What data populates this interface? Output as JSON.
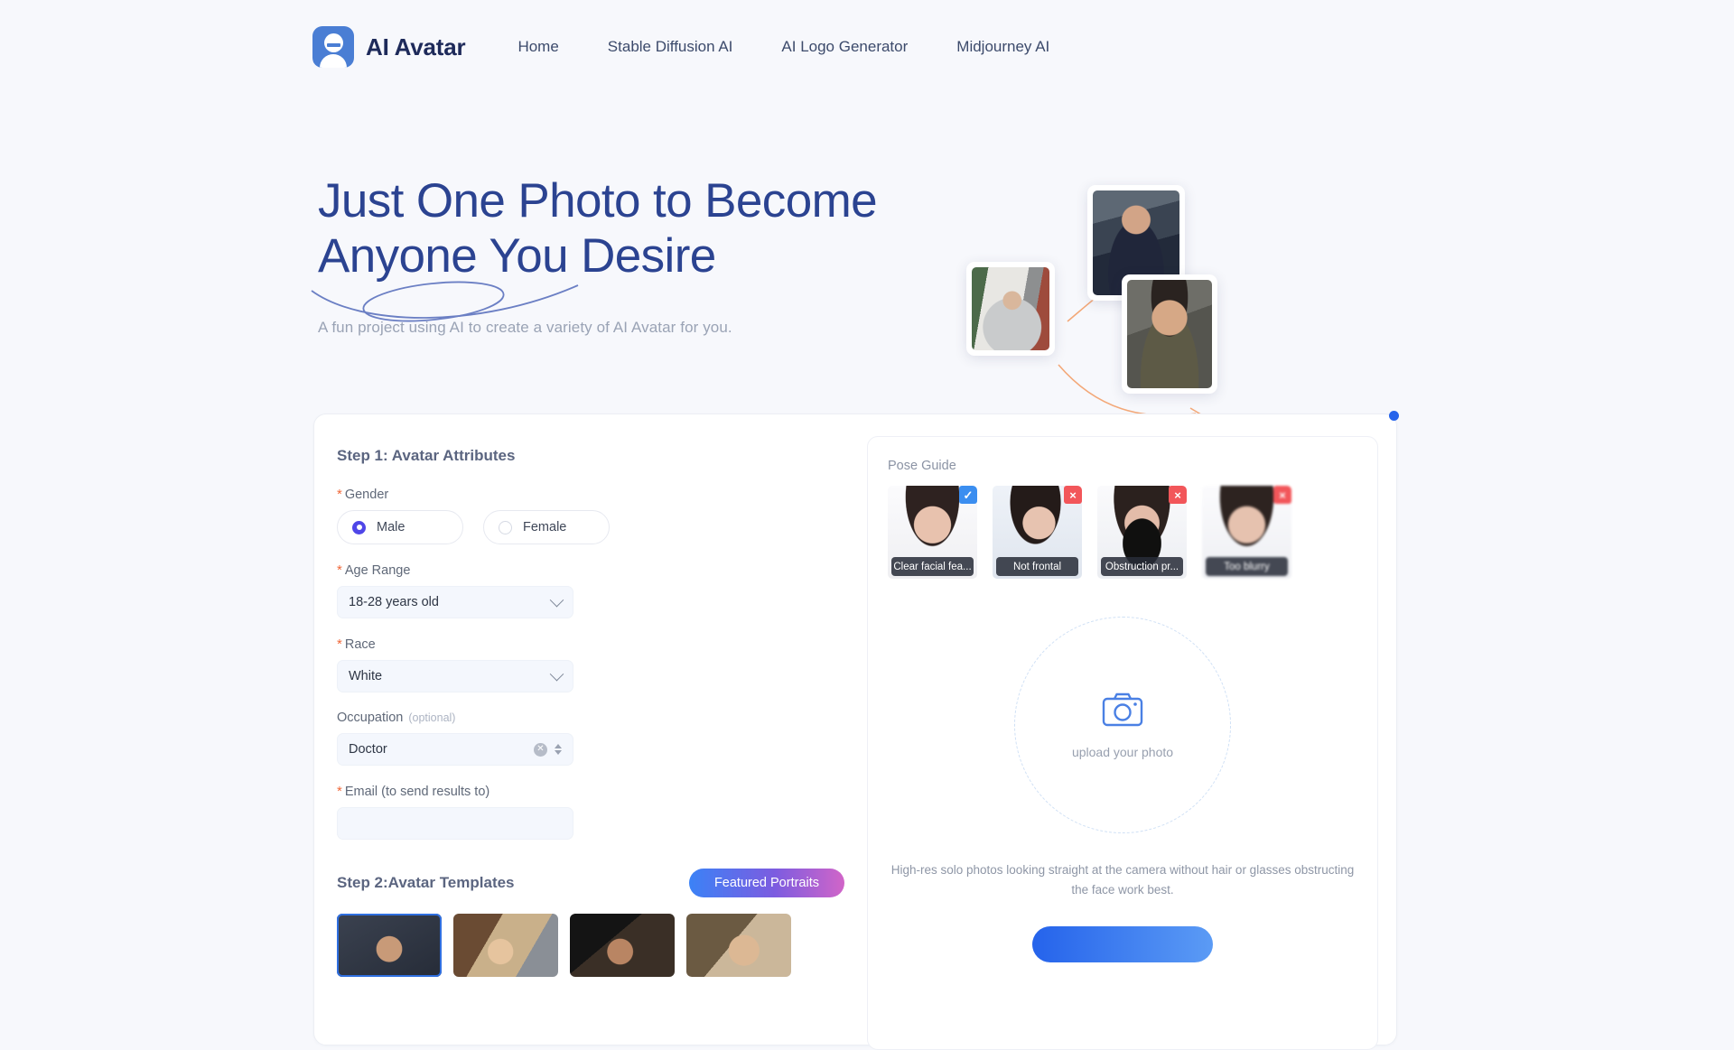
{
  "header": {
    "brand_name": "AI Avatar",
    "nav": [
      {
        "label": "Home"
      },
      {
        "label": "Stable Diffusion AI"
      },
      {
        "label": "AI Logo Generator"
      },
      {
        "label": "Midjourney AI"
      }
    ]
  },
  "hero": {
    "title_line1": "Just One Photo to Become",
    "title_line2": "Anyone You Desire",
    "subtitle": "A fun project using AI to create a variety of AI Avatar for you."
  },
  "form": {
    "step1_title": "Step 1: Avatar Attributes",
    "gender": {
      "label": "Gender",
      "required": "*",
      "options": [
        {
          "label": "Male",
          "selected": true
        },
        {
          "label": "Female",
          "selected": false
        }
      ]
    },
    "age_range": {
      "label": "Age Range",
      "required": "*",
      "value": "18-28 years old"
    },
    "race": {
      "label": "Race",
      "required": "*",
      "value": "White"
    },
    "occupation": {
      "label": "Occupation",
      "optional_tag": "(optional)",
      "value": "Doctor"
    },
    "email": {
      "label": "Email (to send results to)",
      "required": "*",
      "value": "",
      "placeholder": ""
    },
    "step2_title": "Step 2:Avatar Templates",
    "featured_button": "Featured Portraits",
    "templates": [
      {
        "name": "template-1",
        "selected": true
      },
      {
        "name": "template-2",
        "selected": false
      },
      {
        "name": "template-3",
        "selected": false
      },
      {
        "name": "template-4",
        "selected": false
      }
    ]
  },
  "pose_guide": {
    "label": "Pose Guide",
    "items": [
      {
        "caption": "Clear facial fea...",
        "badge": "✓",
        "status": "ok"
      },
      {
        "caption": "Not frontal",
        "badge": "×",
        "status": "no"
      },
      {
        "caption": "Obstruction pr...",
        "badge": "×",
        "status": "no"
      },
      {
        "caption": "Too blurry",
        "badge": "×",
        "status": "no"
      }
    ]
  },
  "upload": {
    "icon": "camera-icon",
    "text": "upload your photo",
    "hint": "High-res solo photos looking straight at the camera without hair or glasses obstructing the face work best.",
    "submit_label": ""
  },
  "colors": {
    "brand_blue": "#4a7ed4",
    "heading_blue": "#2b4391",
    "accent_indigo": "#4f46e8",
    "required_orange": "#f0693a",
    "badge_ok": "#3b8ef0",
    "badge_no": "#f2565a",
    "page_bg": "#f7f8fc"
  }
}
